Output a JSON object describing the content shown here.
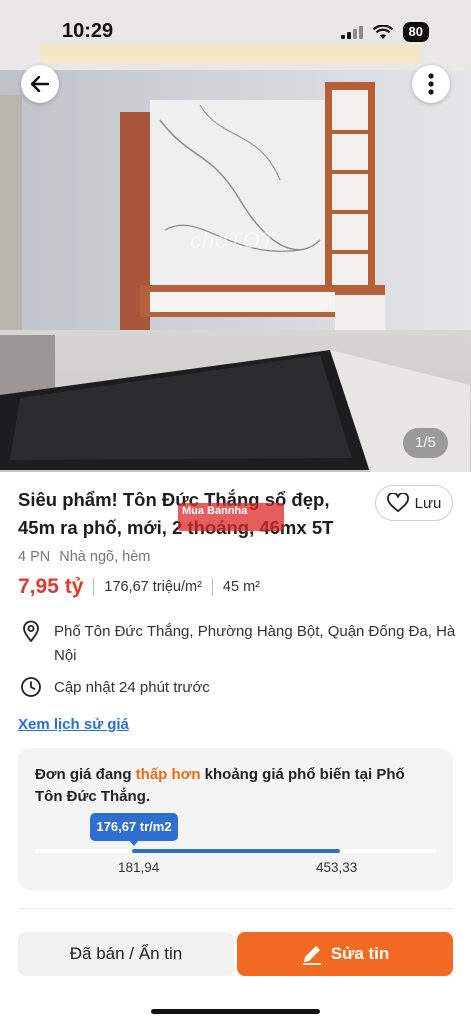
{
  "status_bar": {
    "time": "10:29",
    "battery": "80"
  },
  "photo": {
    "watermark": "choTOT",
    "counter": "1/5"
  },
  "listing": {
    "title": "Siêu phẩm! Tôn Đức Thắng sổ đẹp, 45m ra phố, mới, 2 thoáng, 46mx 5T",
    "stamp_text": "Mua Bannha",
    "bedrooms": "4 PN",
    "property_type": "Nhà ngõ, hèm",
    "price": "7,95 tỷ",
    "price_per_m2": "176,67 triệu/m²",
    "area": "45 m²",
    "address": "Phố Tôn Đức Thắng, Phường Hàng Bột, Quận Đống Đa, Hà Nội",
    "updated": "Cập nhật 24 phút trước",
    "history_link": "Xem lịch sử giá"
  },
  "save_button": {
    "label": "Lưu"
  },
  "price_card": {
    "text_before": "Đơn giá đang ",
    "text_accent": "thấp hơn",
    "text_after": " khoảng giá phổ biến tại Phố Tôn Đức Thắng.",
    "current_label": "176,67 tr/m2",
    "range_low": "181,94",
    "range_high": "453,33",
    "accent_color": "#e86a1c",
    "bar_color": "#2f6fcf"
  },
  "actions": {
    "sold_label": "Đã bán / Ẩn tin",
    "edit_label": "Sửa tin",
    "edit_color": "#f26a21"
  }
}
